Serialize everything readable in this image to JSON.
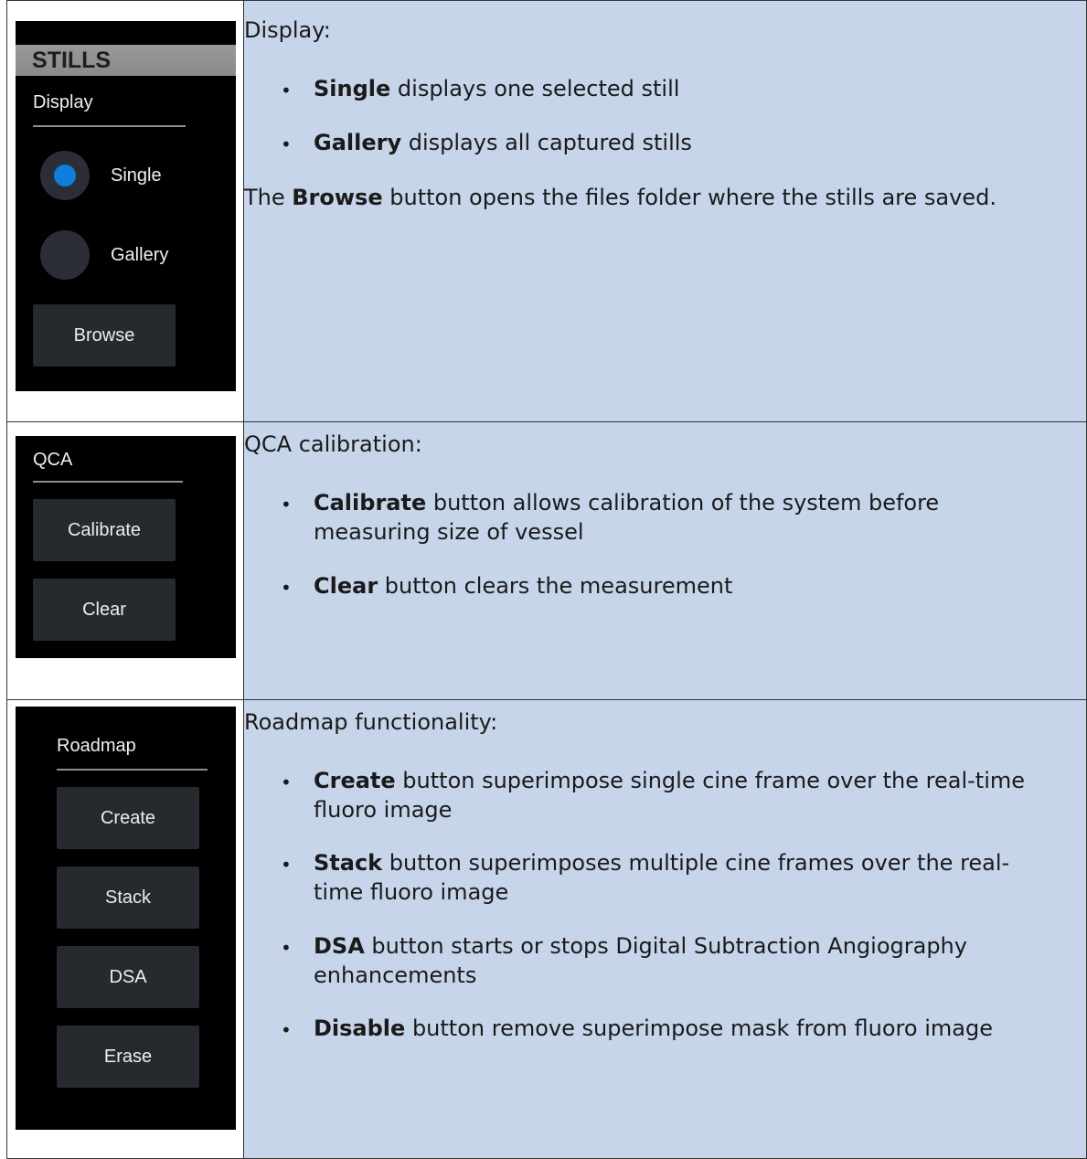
{
  "stills_panel": {
    "header": "STILLS",
    "section_label": "Display",
    "radio_single": "Single",
    "radio_gallery": "Gallery",
    "browse_button": "Browse",
    "selected": "Single",
    "accent_color": "#0e7fdc"
  },
  "qca_panel": {
    "section_label": "QCA",
    "calibrate_button": "Calibrate",
    "clear_button": "Clear"
  },
  "roadmap_panel": {
    "section_label": "Roadmap",
    "create_button": "Create",
    "stack_button": "Stack",
    "dsa_button": "DSA",
    "erase_button": "Erase"
  },
  "row1": {
    "heading": "Display:",
    "b1_bold": "Single",
    "b1_text": " displays one selected still",
    "b2_bold": "Gallery",
    "b2_text": " displays all captured stills",
    "p_pre": "The ",
    "p_bold": "Browse",
    "p_post": " button opens the files folder where the stills are saved."
  },
  "row2": {
    "heading": "QCA calibration:",
    "b1_bold": "Calibrate",
    "b1_text": " button allows calibration of the system before measuring size of vessel",
    "b2_bold": "Clear",
    "b2_text": " button clears the measurement"
  },
  "row3": {
    "heading": "Roadmap functionality:",
    "b1_bold": "Create",
    "b1_text": " button superimpose single cine frame over the real-time fluoro image",
    "b2_bold": "Stack",
    "b2_text": " button superimposes multiple cine frames over the real-time fluoro image",
    "b3_bold": "DSA",
    "b3_text": " button starts or stops Digital Subtraction Angiography enhancements",
    "b4_bold": "Disable",
    "b4_text": " button remove superimpose mask from fluoro image"
  }
}
